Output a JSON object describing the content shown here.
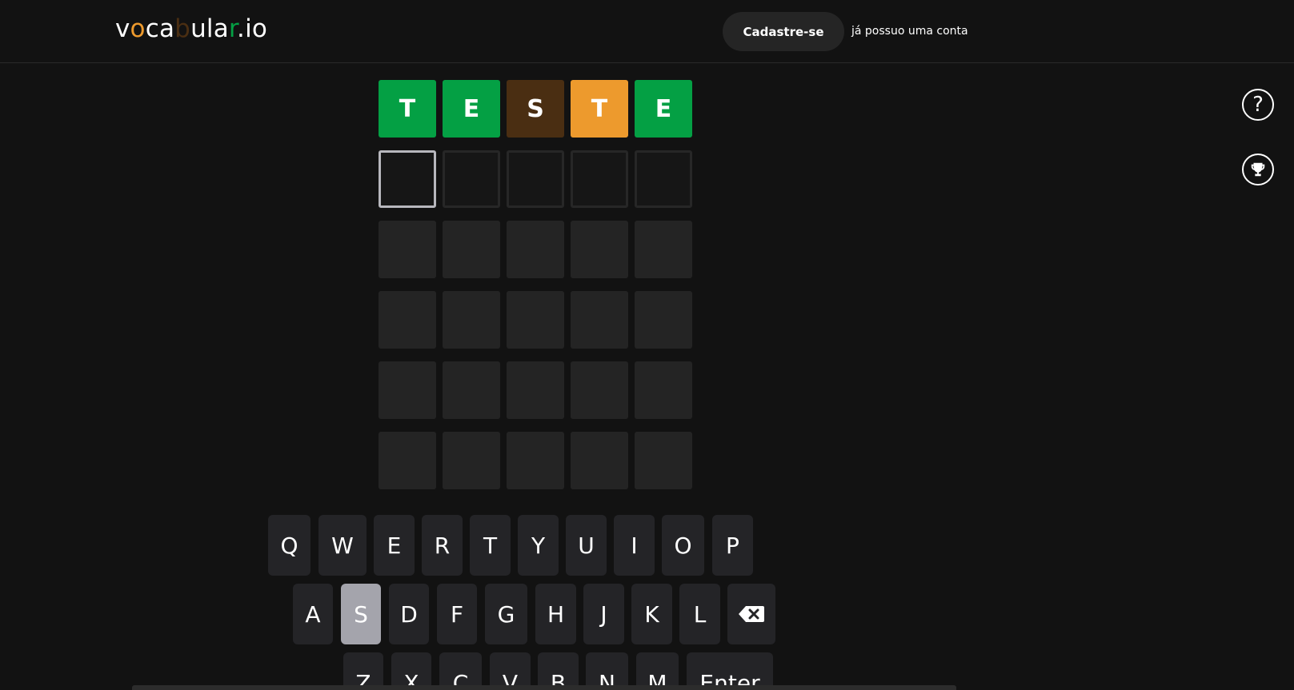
{
  "header": {
    "logo_parts": [
      "v",
      "o",
      "ca",
      "b",
      "ula",
      "r",
      ".io"
    ],
    "logo_colors": [
      "#ffffff",
      "#ed9a2d",
      "#ffffff",
      "#4a2e12",
      "#ffffff",
      "#04a044",
      "#ffffff"
    ],
    "signup_label": "Cadastre-se",
    "login_label": "já possuo uma conta"
  },
  "side": {
    "help_icon": "?",
    "trophy_icon": "trophy-icon"
  },
  "board": {
    "guess_1": [
      "T",
      "E",
      "S",
      "T",
      "E"
    ],
    "guess_1_states": [
      "correct",
      "correct",
      "absent",
      "present",
      "correct"
    ],
    "rows": 6,
    "cols": 5
  },
  "keyboard": {
    "row_1": [
      "Q",
      "W",
      "E",
      "R",
      "T",
      "Y",
      "U",
      "I",
      "O",
      "P"
    ],
    "row_2": [
      "A",
      "S",
      "D",
      "F",
      "G",
      "H",
      "J",
      "K",
      "L"
    ],
    "row_3": [
      "Z",
      "X",
      "C",
      "V",
      "B",
      "N",
      "M"
    ],
    "backspace_icon": "backspace-icon",
    "enter_label": "Enter",
    "used_keys": [
      "S"
    ]
  },
  "colors": {
    "correct": "#04a044",
    "present": "#ed9a2d",
    "absent": "#4a2e12",
    "background": "#121212",
    "key": "#242427",
    "key_used": "#a4a4ac"
  }
}
